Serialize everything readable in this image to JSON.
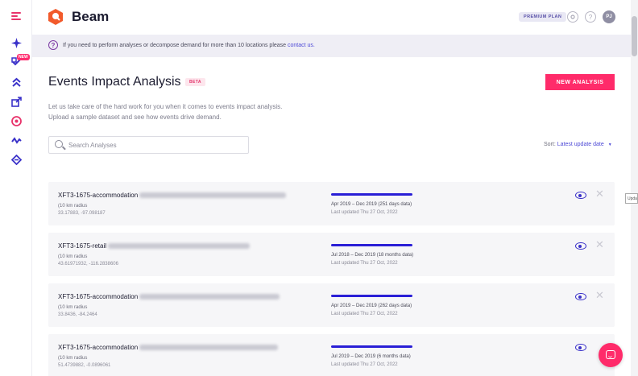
{
  "app": {
    "brand": "Beam",
    "plan_badge": "PREMIUM PLAN",
    "avatar_initials": "PJ",
    "accent_color": "#ff2b6a",
    "primary_color": "#3a31c9"
  },
  "sidebar": {
    "new_badge": "NEW",
    "items": [
      {
        "icon": "sparkle-icon"
      },
      {
        "icon": "check-badge-icon"
      },
      {
        "icon": "chevrons-up-icon"
      },
      {
        "icon": "external-link-icon"
      },
      {
        "icon": "target-icon"
      },
      {
        "icon": "wave-icon"
      },
      {
        "icon": "diamond-arrows-icon"
      }
    ]
  },
  "banner": {
    "text": "If you need to perform analyses or decompose demand for more than 10 locations please",
    "link": "contact us."
  },
  "page": {
    "title": "Events Impact Analysis",
    "beta": "BETA",
    "new_button": "NEW ANALYSIS",
    "intro_line1": "Let us take care of the hard work for you when it comes to events impact analysis.",
    "intro_line2": "Upload a sample dataset and see how events drive demand.",
    "search_placeholder": "Search Analyses",
    "sort_label": "Sort:",
    "sort_value": "Latest update date"
  },
  "analyses": [
    {
      "name": "XFT3-1675-accommodation",
      "radius": "(10 km radius",
      "coords": "33.17883, -97.098187",
      "range": "Apr 2019 – Dec 2019 (251 days data)",
      "updated": "Last updated Thu 27 Oct, 2022"
    },
    {
      "name": "XFT3-1675-retail",
      "radius": "(10 km radius",
      "coords": "43.61971932, -116.2838606",
      "range": "Jul 2018 – Dec 2019 (18 months data)",
      "updated": "Last updated Thu 27 Oct, 2022"
    },
    {
      "name": "XFT3-1675-accommodation",
      "radius": "(10 km radius",
      "coords": "33.8436, -84.2464",
      "range": "Apr 2019 – Dec 2019 (262 days data)",
      "updated": "Last updated Thu 27 Oct, 2022"
    },
    {
      "name": "XFT3-1675-accommodation",
      "radius": "(10 km radius",
      "coords": "51.4739882, -0.0896061",
      "range": "Jul 2019 – Dec 2019 (6 months data)",
      "updated": "Last updated Thu 27 Oct, 2022"
    }
  ],
  "scroll_tooltip": "Upda"
}
